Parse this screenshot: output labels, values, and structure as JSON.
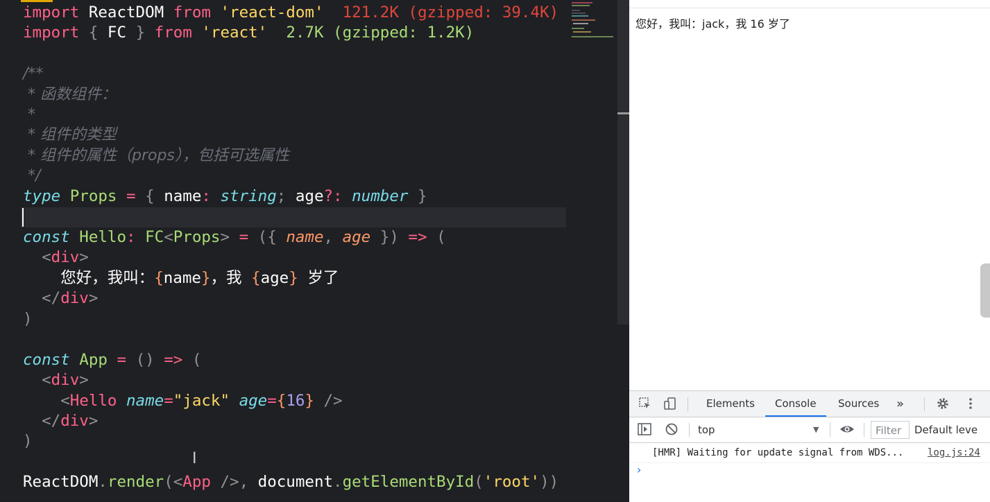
{
  "editor": {
    "line_import_reactdom": {
      "kw1": "import",
      "name": "ReactDOM",
      "kw2": "from",
      "source": "'react-dom'",
      "size": "121.2K (gzipped: 39.4K)"
    },
    "line_import_fc": {
      "kw1": "import",
      "open": "{",
      "name": "FC",
      "close": "}",
      "kw2": "from",
      "source": "'react'",
      "size": "2.7K (gzipped: 1.2K)"
    },
    "comment": {
      "open": "/**",
      "l1": " * 函数组件：",
      "l2": " *",
      "l3": " * 组件的类型",
      "l4": " * 组件的属性（props），包括可选属性",
      "close": " */"
    },
    "type_line": {
      "kw": "type",
      "name": "Props",
      "eq": "=",
      "open": "{",
      "p1": "name",
      "colon1": ":",
      "t1": "string",
      "semi": ";",
      "p2": "age",
      "opt": "?:",
      "t2": "number",
      "close": "}"
    },
    "hello_line": {
      "kw": "const",
      "name": "Hello",
      "colon": ":",
      "type": "FC",
      "lt": "<",
      "tparam": "Props",
      "gt": ">",
      "eq": "=",
      "paren_open": "({",
      "p1": "name",
      "comma": ",",
      "p2": "age",
      "paren_close": "})",
      "arrow": "=>",
      "open": "("
    },
    "hello_div_open": {
      "lt": "<",
      "tag": "div",
      "gt": ">"
    },
    "hello_text": {
      "t1": "您好，我叫：",
      "b1": "{",
      "v1": "name",
      "b2": "}",
      "t2": "，我",
      "b3": "{",
      "v2": "age",
      "b4": "}",
      "t3": "岁了"
    },
    "hello_div_close": {
      "lt": "</",
      "tag": "div",
      "gt": ">"
    },
    "hello_close": ")",
    "app_line": {
      "kw": "const",
      "name": "App",
      "eq": "=",
      "params": "()",
      "arrow": "=>",
      "open": "("
    },
    "app_div_open": {
      "lt": "<",
      "tag": "div",
      "gt": ">"
    },
    "app_hello": {
      "lt": "<",
      "tag": "Hello",
      "a1": "name",
      "eq1": "=",
      "v1": "\"jack\"",
      "a2": "age",
      "eq2": "=",
      "b1": "{",
      "v2": "16",
      "b2": "}",
      "close": "/>"
    },
    "app_div_close": {
      "lt": "</",
      "tag": "div",
      "gt": ">"
    },
    "app_close": ")",
    "render_line": {
      "obj": "ReactDOM",
      "dot": ".",
      "fn": "render",
      "p1": "(",
      "lt": "<",
      "tag": "App",
      "sc": "/>",
      "comma": ",",
      "doc": "document",
      "dot2": ".",
      "fn2": "getElementById",
      "p2": "(",
      "arg": "'root'",
      "p3": "))"
    },
    "ibeam": "I"
  },
  "browser": {
    "page_text": "您好，我叫：jack，我 16 岁了"
  },
  "devtools": {
    "tabs": [
      "Elements",
      "Console",
      "Sources"
    ],
    "more_icon": "»",
    "context": "top",
    "filter_placeholder": "Filter",
    "levels": "Default leve",
    "message": "[HMR] Waiting for update signal from WDS...",
    "message_source": "log.js:24",
    "prompt": "›"
  },
  "colors": {
    "keyword": "#ff6188",
    "string": "#ffd866",
    "class": "#a9dc76",
    "type": "#78dce8",
    "param": "#fc9867",
    "number": "#ab9df2",
    "accent": "#1a73e8"
  }
}
